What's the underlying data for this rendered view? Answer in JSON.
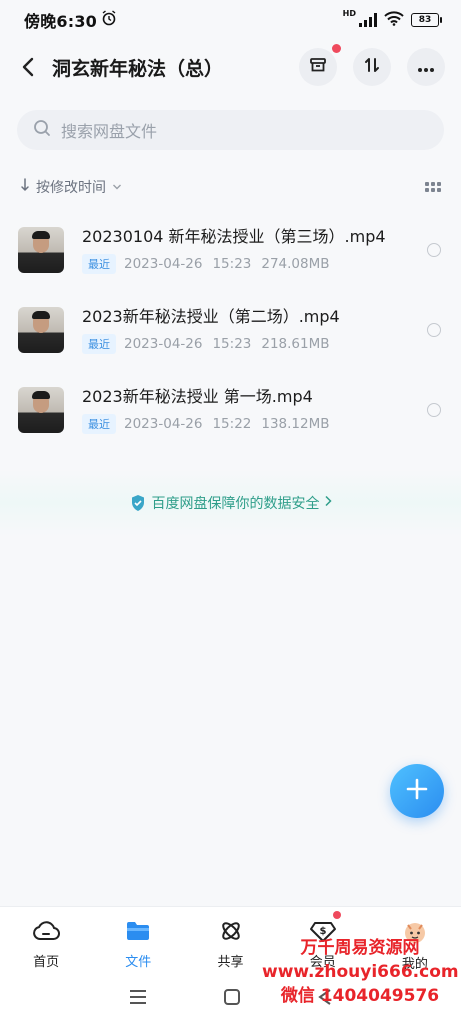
{
  "status": {
    "time": "傍晚6:30",
    "battery": "83",
    "network_label": "HD"
  },
  "header": {
    "title": "洞玄新年秘法（总）"
  },
  "search": {
    "placeholder": "搜索网盘文件"
  },
  "sort": {
    "label": "按修改时间"
  },
  "files": [
    {
      "name": "20230104 新年秘法授业（第三场）.mp4",
      "badge": "最近",
      "date": "2023-04-26",
      "time": "15:23",
      "size": "274.08MB"
    },
    {
      "name": "2023新年秘法授业（第二场）.mp4",
      "badge": "最近",
      "date": "2023-04-26",
      "time": "15:23",
      "size": "218.61MB"
    },
    {
      "name": "2023新年秘法授业 第一场.mp4",
      "badge": "最近",
      "date": "2023-04-26",
      "time": "15:22",
      "size": "138.12MB"
    }
  ],
  "secure_notice": "百度网盘保障你的数据安全",
  "tabs": [
    {
      "label": "首页",
      "icon": "home-cloud-icon",
      "active": false
    },
    {
      "label": "文件",
      "icon": "folder-icon",
      "active": true
    },
    {
      "label": "共享",
      "icon": "share-icon",
      "active": false
    },
    {
      "label": "会员",
      "icon": "vip-icon",
      "active": false
    },
    {
      "label": "我的",
      "icon": "profile-icon",
      "active": false
    }
  ],
  "watermark": {
    "line1": "万千周易资源网",
    "line2": "www.zhouyi666.com",
    "line3": "微信 1404049576"
  },
  "colors": {
    "accent": "#2b8df0",
    "secure": "#2f9e8a",
    "red_dot": "#ef4a5d",
    "watermark": "#e8242a"
  }
}
